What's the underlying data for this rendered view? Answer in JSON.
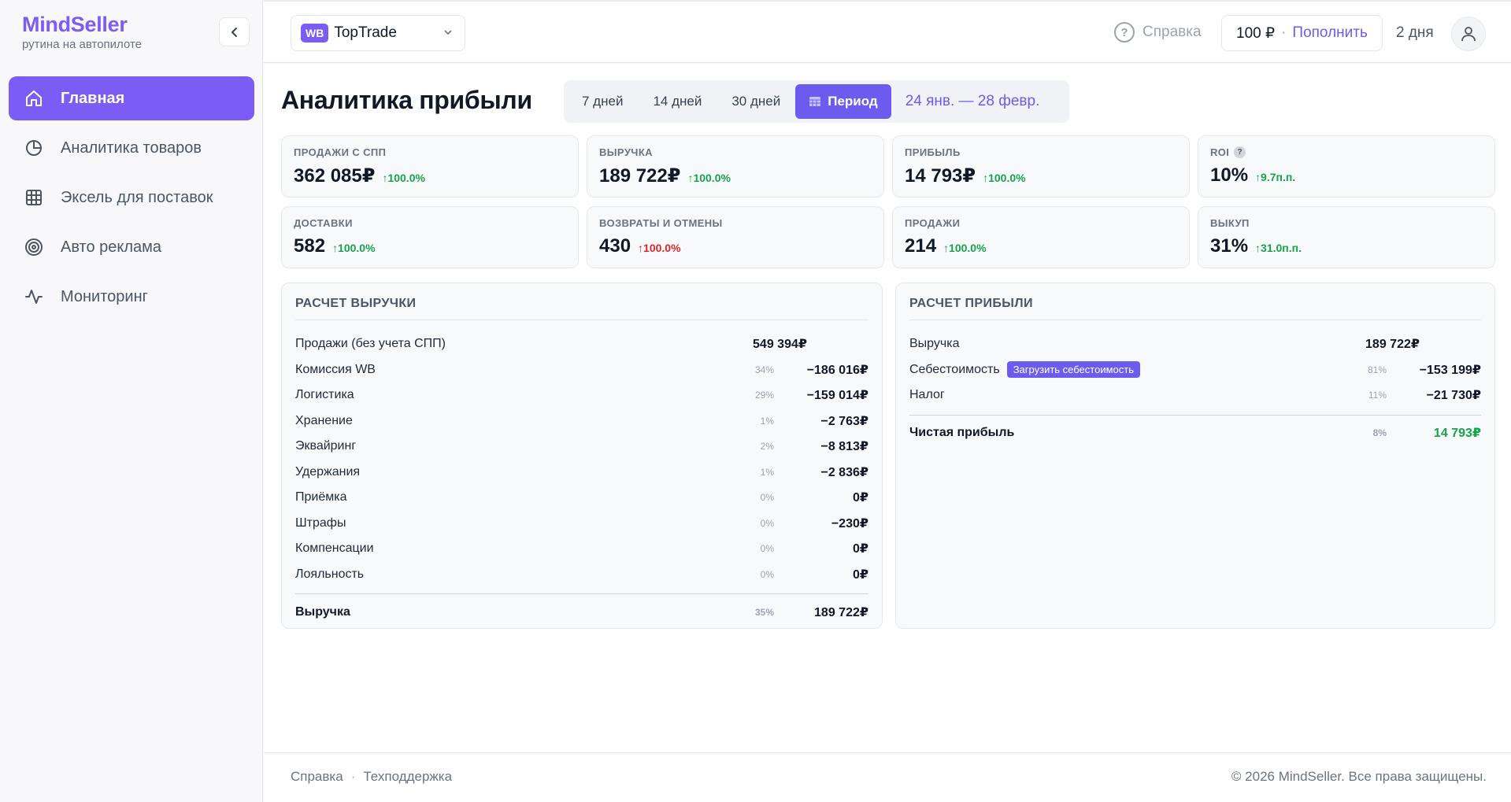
{
  "brand": {
    "name": "MindSeller",
    "tagline": "рутина на автопилоте"
  },
  "sidebar": {
    "items": [
      {
        "label": "Главная",
        "icon": "home-icon",
        "active": true
      },
      {
        "label": "Аналитика товаров",
        "icon": "pie-chart-icon"
      },
      {
        "label": "Эксель для поставок",
        "icon": "grid-icon"
      },
      {
        "label": "Авто реклама",
        "icon": "target-icon"
      },
      {
        "label": "Мониторинг",
        "icon": "activity-icon"
      }
    ]
  },
  "header": {
    "shop_badge": "WB",
    "shop_name": "TopTrade",
    "help_label": "Справка",
    "balance_amount": "100 ₽",
    "balance_sep": "·",
    "topup_label": "Пополнить",
    "days_left": "2 дня"
  },
  "main": {
    "title": "Аналитика прибыли",
    "periods": [
      "7 дней",
      "14 дней",
      "30 дней"
    ],
    "period_active": "Период",
    "date_range": "24 янв. — 28 февр."
  },
  "kpis": [
    {
      "label": "ПРОДАЖИ С СПП",
      "value": "362 085₽",
      "delta": "↑100.0%",
      "tone": "up"
    },
    {
      "label": "ВЫРУЧКА",
      "value": "189 722₽",
      "delta": "↑100.0%",
      "tone": "up"
    },
    {
      "label": "ПРИБЫЛЬ",
      "value": "14 793₽",
      "delta": "↑100.0%",
      "tone": "up"
    },
    {
      "label": "ROI",
      "value": "10%",
      "delta": "↑9.7п.п.",
      "tone": "up",
      "help": "?"
    },
    {
      "label": "ДОСТАВКИ",
      "value": "582",
      "delta": "↑100.0%",
      "tone": "up"
    },
    {
      "label": "ВОЗВРАТЫ И ОТМЕНЫ",
      "value": "430",
      "delta": "↑100.0%",
      "tone": "bad"
    },
    {
      "label": "ПРОДАЖИ",
      "value": "214",
      "delta": "↑100.0%",
      "tone": "up"
    },
    {
      "label": "ВЫКУП",
      "value": "31%",
      "delta": "↑31.0п.п.",
      "tone": "up"
    }
  ],
  "revenue_panel": {
    "title": "РАСЧЕТ ВЫРУЧКИ",
    "rows": [
      {
        "label": "Продажи (без учета СПП)",
        "pct": "",
        "value": "549 394₽",
        "mid": true
      },
      {
        "label": "Комиссия WB",
        "pct": "34%",
        "value": "−186 016₽"
      },
      {
        "label": "Логистика",
        "pct": "29%",
        "value": "−159 014₽"
      },
      {
        "label": "Хранение",
        "pct": "1%",
        "value": "−2 763₽"
      },
      {
        "label": "Эквайринг",
        "pct": "2%",
        "value": "−8 813₽"
      },
      {
        "label": "Удержания",
        "pct": "1%",
        "value": "−2 836₽"
      },
      {
        "label": "Приёмка",
        "pct": "0%",
        "value": "0₽"
      },
      {
        "label": "Штрафы",
        "pct": "0%",
        "value": "−230₽"
      },
      {
        "label": "Компенсации",
        "pct": "0%",
        "value": "0₽"
      },
      {
        "label": "Лояльность",
        "pct": "0%",
        "value": "0₽"
      }
    ],
    "total": {
      "label": "Выручка",
      "pct": "35%",
      "value": "189 722₽"
    }
  },
  "profit_panel": {
    "title": "РАСЧЕТ ПРИБЫЛИ",
    "rows": [
      {
        "label": "Выручка",
        "pct": "",
        "value": "189 722₽",
        "mid": true
      },
      {
        "label": "Себестоимость",
        "pct": "81%",
        "value": "−153 199₽",
        "button": "Загрузить себестоимость"
      },
      {
        "label": "Налог",
        "pct": "11%",
        "value": "−21 730₽"
      }
    ],
    "total": {
      "label": "Чистая прибыль",
      "pct": "8%",
      "value": "14 793₽"
    }
  },
  "footer": {
    "links": [
      "Справка",
      "Техподдержка"
    ],
    "sep": "·",
    "copyright": "© 2026 MindSeller. Все права защищены."
  },
  "colors": {
    "accent": "#7b5cf5",
    "positive": "#16a34a",
    "negative": "#dc2626"
  }
}
